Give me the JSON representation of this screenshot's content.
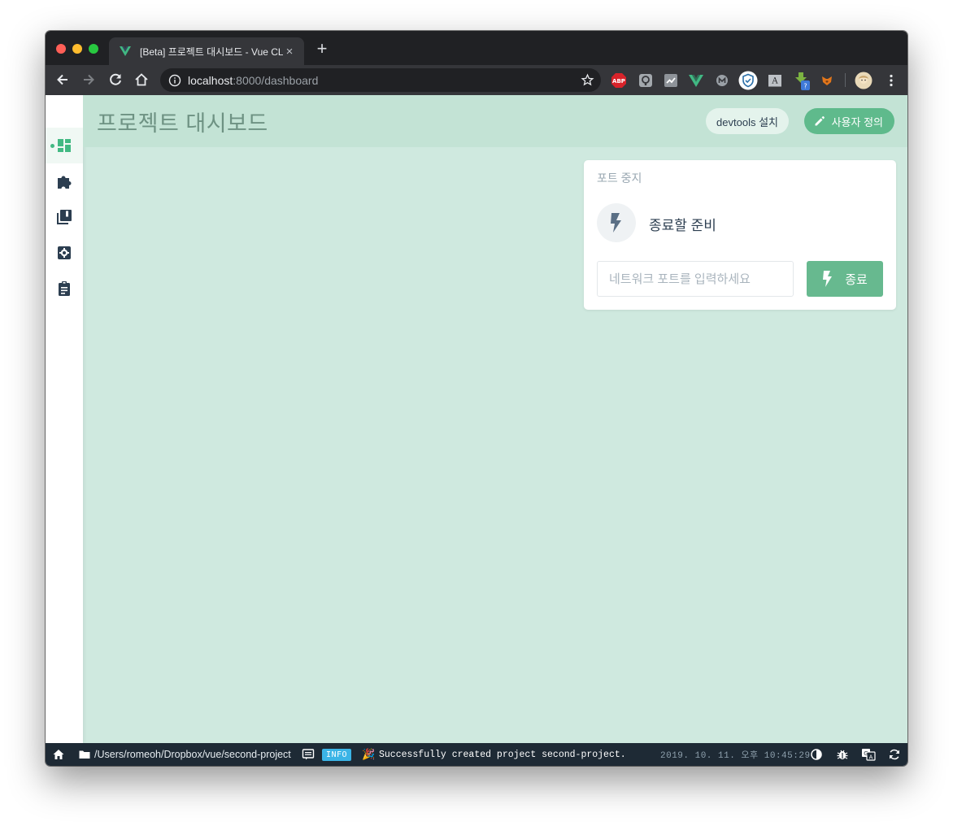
{
  "browser": {
    "tab_title": "[Beta] 프로젝트 대시보드 - Vue CLI",
    "close_glyph": "×",
    "newtab_glyph": "+",
    "url_host": "localhost",
    "url_rest": ":8000/dashboard"
  },
  "extensions": [
    "abp-icon",
    "lighthouse-icon",
    "analytics-icon",
    "vue-devtools-icon",
    "metamask-m-icon",
    "shield-icon",
    "accessibility-icon",
    "download-icon",
    "fox-icon",
    "profile-avatar"
  ],
  "sidebar": {
    "items": [
      {
        "name": "dashboard",
        "active": true
      },
      {
        "name": "plugins"
      },
      {
        "name": "dependencies"
      },
      {
        "name": "configuration"
      },
      {
        "name": "tasks"
      }
    ]
  },
  "header": {
    "title": "프로젝트 대시보드",
    "devtools_label": "devtools 설치",
    "customize_label": "사용자 정의"
  },
  "widget": {
    "title": "포트 중지",
    "status": "종료할 준비",
    "input_placeholder": "네트워크 포트를 입력하세요",
    "stop_label": "종료"
  },
  "statusbar": {
    "path": "/Users/romeoh/Dropbox/vue/second-project",
    "level": "INFO",
    "emoji": "🎉",
    "message": "Successfully created project second-project.",
    "timestamp": "2019. 10. 11. 오후 10:45:29"
  },
  "colors": {
    "accent": "#42b983",
    "app_bg": "#cfe9df",
    "header_bg": "#c3e3d5",
    "statusbar_bg": "#1e2a35",
    "info_badge": "#3bb4e6"
  }
}
